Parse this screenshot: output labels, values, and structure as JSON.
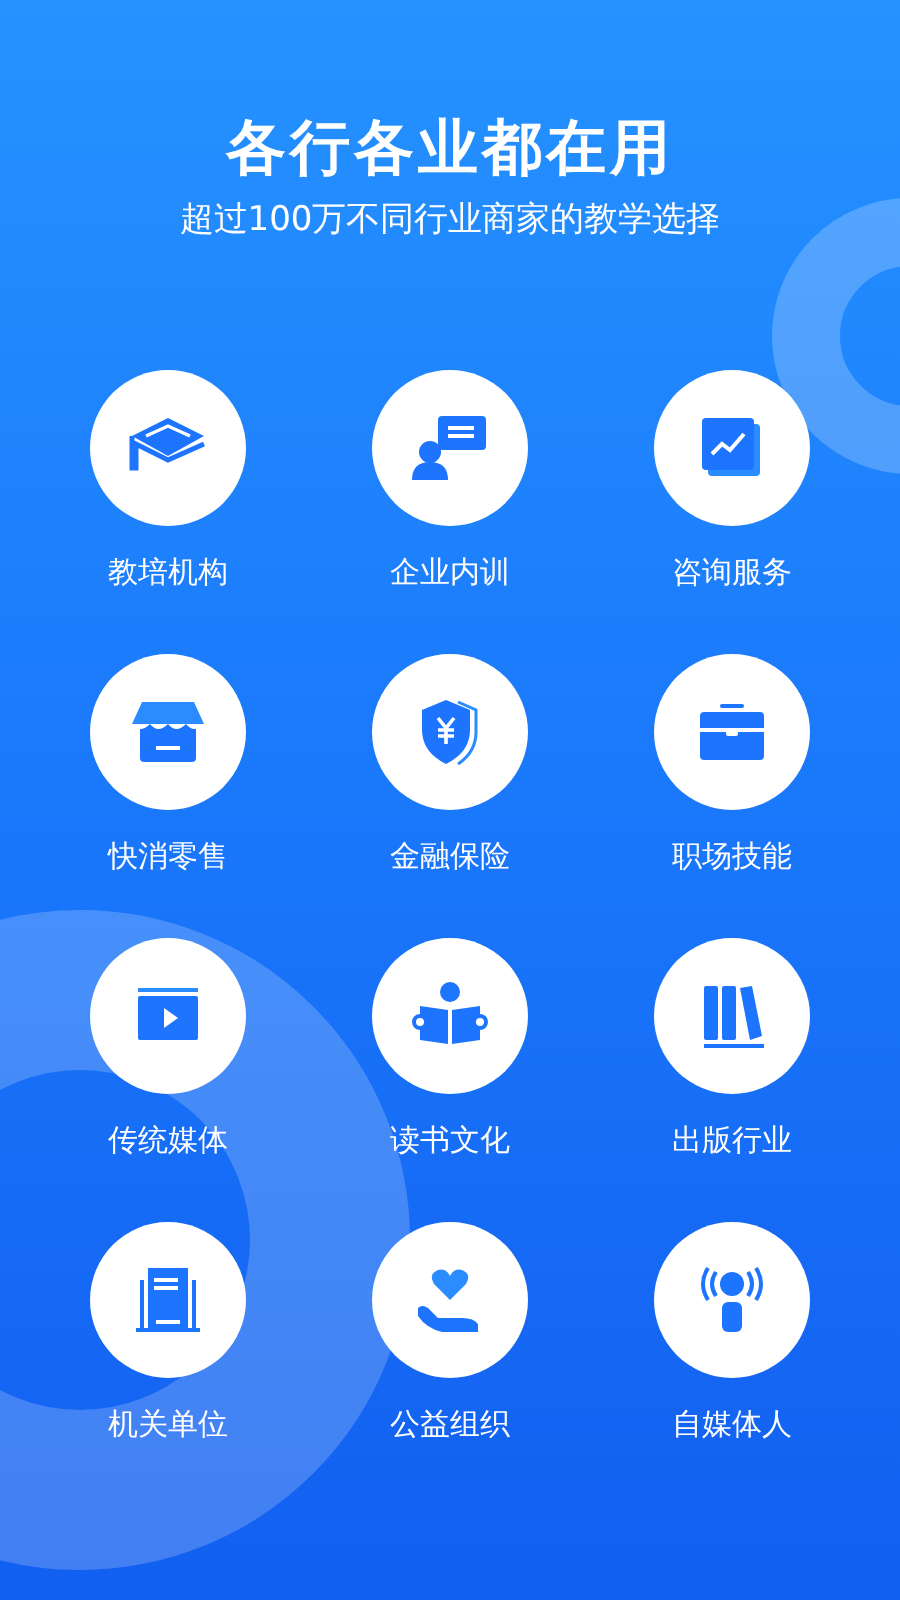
{
  "title": "各行各业都在用",
  "subtitle": "超过100万不同行业商家的教学选择",
  "industries": [
    {
      "label": "教培机构",
      "kind": "cap"
    },
    {
      "label": "企业内训",
      "kind": "trainer"
    },
    {
      "label": "咨询服务",
      "kind": "chart"
    },
    {
      "label": "快消零售",
      "kind": "shop"
    },
    {
      "label": "金融保险",
      "kind": "shield"
    },
    {
      "label": "职场技能",
      "kind": "briefcase"
    },
    {
      "label": "传统媒体",
      "kind": "video"
    },
    {
      "label": "读书文化",
      "kind": "reader"
    },
    {
      "label": "出版行业",
      "kind": "books"
    },
    {
      "label": "机关单位",
      "kind": "building"
    },
    {
      "label": "公益组织",
      "kind": "charity"
    },
    {
      "label": "自媒体人",
      "kind": "speaker"
    }
  ]
}
